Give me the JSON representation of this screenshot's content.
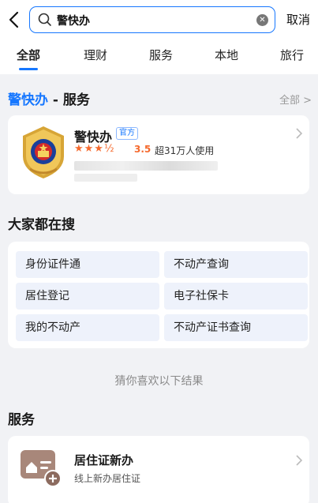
{
  "search": {
    "query": "警快办",
    "cancel_label": "取消"
  },
  "tabs": [
    {
      "label": "全部",
      "active": true
    },
    {
      "label": "理财"
    },
    {
      "label": "服务"
    },
    {
      "label": "本地"
    },
    {
      "label": "旅行"
    }
  ],
  "result_section": {
    "keyword": "警快办",
    "suffix": " - 服务",
    "more_label": "全部 >"
  },
  "app": {
    "name": "警快办",
    "badge": "官方",
    "rating": "3.5",
    "stars": "★★★½",
    "users": "超31万人使用"
  },
  "hot": {
    "title": "大家都在搜",
    "items": [
      "身份证件通",
      "不动产查询",
      "居住登记",
      "电子社保卡",
      "我的不动产",
      "不动产证书查询"
    ]
  },
  "guess_label": "猜你喜欢以下结果",
  "services": {
    "title": "服务",
    "item": {
      "title": "居住证新办",
      "subtitle": "线上新办居住证"
    }
  },
  "colors": {
    "accent": "#1677ff",
    "star": "#f56a2e",
    "chip_bg": "#eef2fb"
  }
}
